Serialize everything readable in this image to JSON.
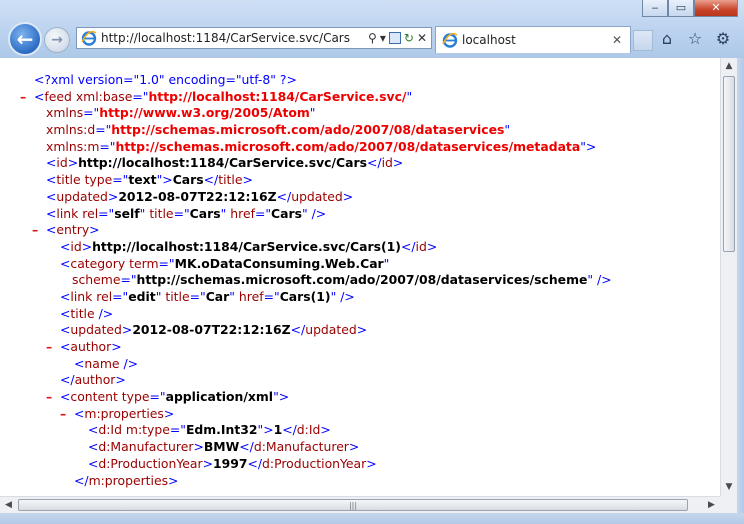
{
  "window": {
    "controls": {
      "minimize": "‒",
      "maximize": "▭",
      "close": "✕"
    }
  },
  "nav": {
    "back_icon": "arrow-left",
    "forward_icon": "arrow-right"
  },
  "address": {
    "url": "http://localhost:1184/CarService.svc/Cars",
    "search_glyph": "⚲",
    "dropdown_glyph": "▾",
    "refresh_glyph": "↻",
    "stop_glyph": "✕"
  },
  "tab": {
    "label": "localhost",
    "close_glyph": "✕"
  },
  "toolbar": {
    "home_glyph": "⌂",
    "favorites_glyph": "☆",
    "tools_glyph": "⚙"
  },
  "xml": {
    "decl": "<?xml version=\"1.0\" encoding=\"utf-8\" ?>",
    "toggle_glyph": "–",
    "feed_base": "http://localhost:1184/CarService.svc/",
    "xmlns": "http://www.w3.org/2005/Atom",
    "xmlns_d": "http://schemas.microsoft.com/ado/2007/08/dataservices",
    "xmlns_m": "http://schemas.microsoft.com/ado/2007/08/dataservices/metadata",
    "feed_id": "http://localhost:1184/CarService.svc/Cars",
    "title_type": "text",
    "title": "Cars",
    "updated": "2012-08-07T22:12:16Z",
    "link_rel": "self",
    "link_title": "Cars",
    "link_href": "Cars",
    "entry_id": "http://localhost:1184/CarService.svc/Cars(1)",
    "category_term": "MK.oDataConsuming.Web.Car",
    "category_scheme": "http://schemas.microsoft.com/ado/2007/08/dataservices/scheme",
    "entry_link_rel": "edit",
    "entry_link_title": "Car",
    "entry_link_href": "Cars(1)",
    "entry_updated": "2012-08-07T22:12:16Z",
    "content_type": "application/xml",
    "id_type": "Edm.Int32",
    "id_value": "1",
    "manufacturer": "BMW",
    "production_year": "1997"
  }
}
